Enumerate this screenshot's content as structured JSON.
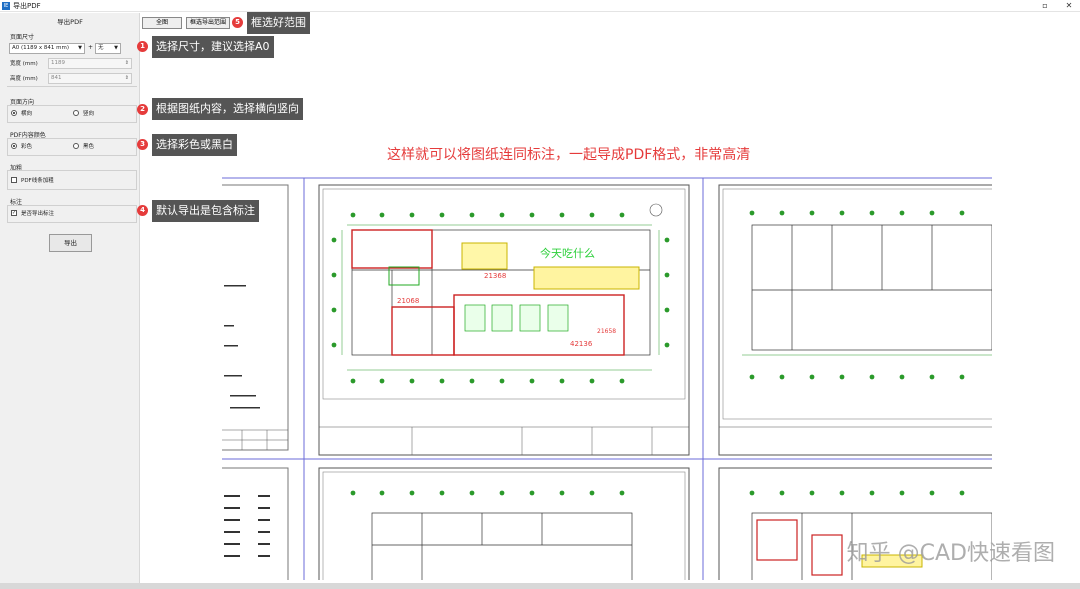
{
  "window": {
    "title": "导出PDF",
    "icon_text": "IE"
  },
  "sidebar": {
    "heading": "导出PDF",
    "page_size": {
      "title": "页面尺寸",
      "size_select": "A0 (1189 x 841 mm)",
      "margin_select": "无",
      "width_label": "宽度 (mm)",
      "width_value": "1189",
      "height_label": "高度 (mm)",
      "height_value": "841"
    },
    "orientation": {
      "title": "页面方向",
      "landscape": "横向",
      "portrait": "竖向",
      "selected": "landscape"
    },
    "color": {
      "title": "PDF内容颜色",
      "color_opt": "彩色",
      "bw_opt": "黑色",
      "selected": "color"
    },
    "bold": {
      "title": "加粗",
      "checkbox_label": "PDF线条加粗",
      "checked": false
    },
    "annot": {
      "title": "标注",
      "checkbox_label": "是否导出标注",
      "checked": true
    },
    "export_label": "导出"
  },
  "toolbar": {
    "full_label": "全图",
    "select_label": "框选导出范围"
  },
  "callouts": [
    {
      "num": "1",
      "text": "选择尺寸，建议选择A0"
    },
    {
      "num": "2",
      "text": "根据图纸内容，选择横向竖向"
    },
    {
      "num": "3",
      "text": "选择彩色或黑白"
    },
    {
      "num": "4",
      "text": "默认导出是包含标注"
    },
    {
      "num": "5",
      "text": "框选好范围"
    }
  ],
  "headline": "这样就可以将图纸连同标注，一起导成PDF格式，非常高清",
  "drawing": {
    "note_text": "今天吃什么",
    "dim1": "21368",
    "dim2": "21068",
    "dim3": "42136",
    "dim4": "21658"
  },
  "watermark": "知乎 @CAD快速看图",
  "colors": {
    "accent": "#e53b3b",
    "callout_bg": "#555555",
    "grid": "#6b6bd8"
  }
}
